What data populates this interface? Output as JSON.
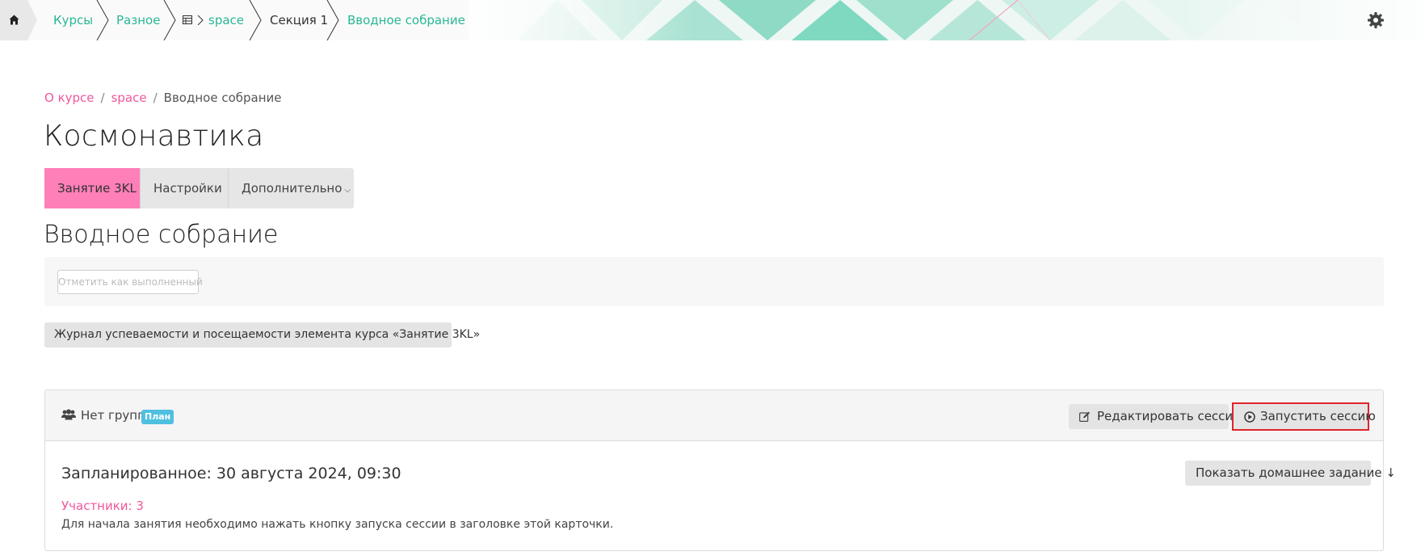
{
  "topbar": {
    "crumbs": [
      "Курсы",
      "Разное",
      "space",
      "Секция 1",
      "Вводное собрание"
    ],
    "colors": {
      "link": "#2ab795",
      "pattern": "#7fd8c0"
    }
  },
  "breadcrumb": {
    "items": [
      "О курсе",
      "space",
      "Вводное собрание"
    ],
    "separator": "/"
  },
  "page": {
    "course_title": "Космонавтика",
    "activity_title": "Вводное собрание"
  },
  "tabs": {
    "active": "Занятие 3KL",
    "settings": "Настройки",
    "more": "Дополнительно"
  },
  "completion": {
    "button": "Отметить как выполненный"
  },
  "journal": {
    "button": "Журнал успеваемости и посещаемости элемента курса «Занятие 3KL»"
  },
  "session": {
    "groups_label": "Нет групп",
    "badge": "План",
    "edit_button": "Редактировать сессию",
    "start_button": "Запустить сессию",
    "scheduled": "Запланированное: 30 августа 2024, 09:30",
    "homework_button": "Показать домашнее задание ↓",
    "participants": "Участники: 3",
    "hint": "Для начала занятия необходимо нажать кнопку запуска сессии в заголовке этой карточки."
  },
  "accent_colors": {
    "pink": "#f0589c",
    "pink_tab": "#ff7fb8",
    "teal": "#2ab795",
    "badge": "#4fc0e0",
    "highlight": "#e0242b"
  }
}
